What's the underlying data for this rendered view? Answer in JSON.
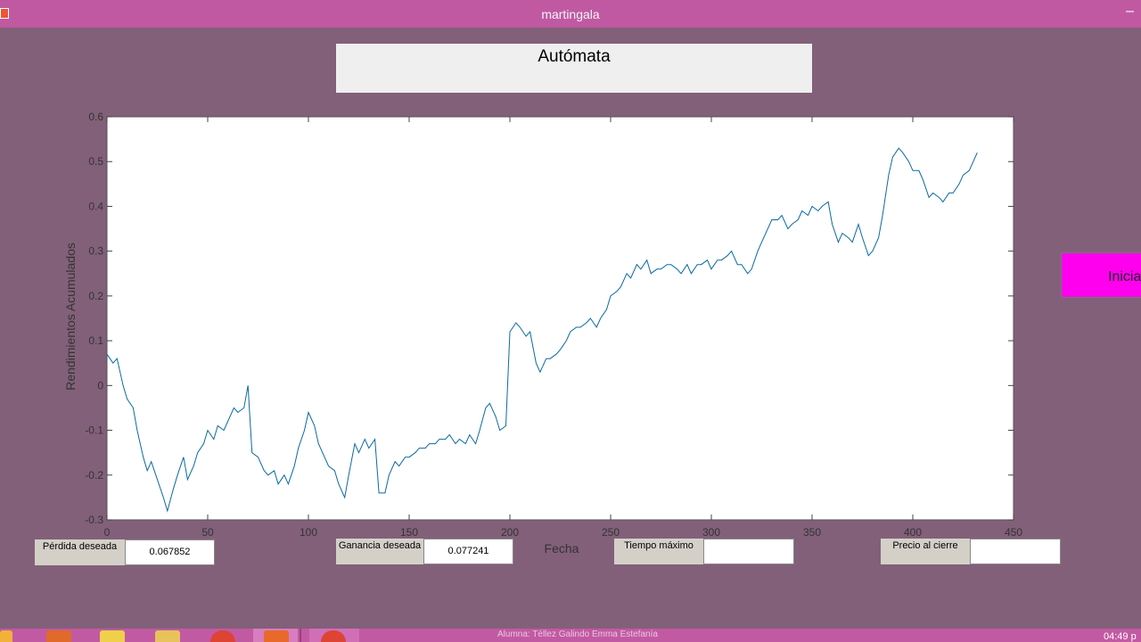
{
  "window": {
    "title": "martingala"
  },
  "header": {
    "title": "Autómata"
  },
  "start_button": {
    "label": "Inicia"
  },
  "fields": [
    {
      "label": "Pérdida deseada",
      "value": "0.067852"
    },
    {
      "label": "Ganancia deseada",
      "value": "0.077241"
    },
    {
      "label": "Tiempo máximo",
      "value": ""
    },
    {
      "label": "Precio al cierre",
      "value": ""
    }
  ],
  "taskbar": {
    "student_text": "Alumna: Téllez Galindo Emma Estefanía",
    "clock": "04:49 p"
  },
  "colors": {
    "window_bg": "#826079",
    "titlebar": "#c059a2",
    "line": "#0a6aa1",
    "start_button": "#ff00ee"
  },
  "chart_data": {
    "type": "line",
    "title": "",
    "xlabel": "Fecha",
    "ylabel": "Rendimientos Acumulados",
    "xlim": [
      0,
      450
    ],
    "ylim": [
      -0.3,
      0.6
    ],
    "xticks": [
      0,
      50,
      100,
      150,
      200,
      250,
      300,
      350,
      400,
      450
    ],
    "yticks": [
      -0.3,
      -0.2,
      -0.1,
      0,
      0.1,
      0.2,
      0.3,
      0.4,
      0.5,
      0.6
    ],
    "series": [
      {
        "x": [
          0,
          3,
          5,
          8,
          10,
          13,
          15,
          18,
          20,
          22,
          25,
          28,
          30,
          33,
          35,
          38,
          40,
          43,
          45,
          48,
          50,
          53,
          55,
          58,
          60,
          63,
          65,
          68,
          70,
          72,
          75,
          78,
          80,
          83,
          85,
          88,
          90,
          93,
          95,
          98,
          100,
          103,
          105,
          108,
          110,
          113,
          115,
          118,
          120,
          123,
          125,
          128,
          130,
          133,
          135,
          138,
          140,
          143,
          145,
          148,
          150,
          153,
          155,
          158,
          160,
          163,
          165,
          168,
          170,
          173,
          175,
          178,
          180,
          183,
          185,
          188,
          190,
          193,
          195,
          198,
          200,
          203,
          205,
          208,
          210,
          213,
          215,
          218,
          220,
          223,
          225,
          228,
          230,
          233,
          235,
          238,
          240,
          243,
          245,
          248,
          250,
          253,
          255,
          258,
          260,
          263,
          265,
          268,
          270,
          273,
          275,
          278,
          280,
          283,
          285,
          288,
          290,
          293,
          295,
          298,
          300,
          303,
          305,
          308,
          310,
          313,
          315,
          318,
          320,
          323,
          325,
          328,
          330,
          333,
          335,
          338,
          340,
          343,
          345,
          348,
          350,
          353,
          355,
          358,
          360,
          363,
          365,
          368,
          370,
          373,
          375,
          378,
          380,
          383,
          385,
          388,
          390,
          393,
          395,
          398,
          400,
          403,
          405,
          408,
          410,
          413,
          415,
          418,
          420,
          423,
          425,
          428,
          430,
          432
        ],
        "y": [
          0.07,
          0.05,
          0.06,
          0.0,
          -0.03,
          -0.05,
          -0.1,
          -0.16,
          -0.19,
          -0.17,
          -0.21,
          -0.25,
          -0.28,
          -0.23,
          -0.2,
          -0.16,
          -0.21,
          -0.18,
          -0.15,
          -0.13,
          -0.1,
          -0.12,
          -0.09,
          -0.1,
          -0.08,
          -0.05,
          -0.06,
          -0.05,
          0.0,
          -0.15,
          -0.16,
          -0.19,
          -0.2,
          -0.19,
          -0.22,
          -0.2,
          -0.22,
          -0.18,
          -0.14,
          -0.1,
          -0.06,
          -0.09,
          -0.13,
          -0.16,
          -0.18,
          -0.19,
          -0.22,
          -0.25,
          -0.2,
          -0.13,
          -0.15,
          -0.12,
          -0.14,
          -0.12,
          -0.24,
          -0.24,
          -0.2,
          -0.17,
          -0.18,
          -0.16,
          -0.16,
          -0.15,
          -0.14,
          -0.14,
          -0.13,
          -0.13,
          -0.12,
          -0.12,
          -0.11,
          -0.13,
          -0.12,
          -0.13,
          -0.11,
          -0.13,
          -0.1,
          -0.05,
          -0.04,
          -0.07,
          -0.1,
          -0.09,
          0.12,
          0.14,
          0.13,
          0.11,
          0.12,
          0.05,
          0.03,
          0.06,
          0.06,
          0.07,
          0.08,
          0.1,
          0.12,
          0.13,
          0.13,
          0.14,
          0.15,
          0.13,
          0.15,
          0.17,
          0.2,
          0.21,
          0.22,
          0.25,
          0.24,
          0.27,
          0.26,
          0.28,
          0.25,
          0.26,
          0.26,
          0.27,
          0.27,
          0.26,
          0.25,
          0.27,
          0.25,
          0.27,
          0.27,
          0.28,
          0.26,
          0.28,
          0.28,
          0.29,
          0.3,
          0.27,
          0.27,
          0.25,
          0.26,
          0.3,
          0.32,
          0.35,
          0.37,
          0.37,
          0.38,
          0.35,
          0.36,
          0.37,
          0.39,
          0.38,
          0.4,
          0.39,
          0.4,
          0.41,
          0.36,
          0.32,
          0.34,
          0.33,
          0.32,
          0.36,
          0.33,
          0.29,
          0.3,
          0.33,
          0.38,
          0.47,
          0.51,
          0.53,
          0.52,
          0.5,
          0.48,
          0.48,
          0.46,
          0.42,
          0.43,
          0.42,
          0.41,
          0.43,
          0.43,
          0.45,
          0.47,
          0.48,
          0.5,
          0.52
        ]
      }
    ]
  }
}
